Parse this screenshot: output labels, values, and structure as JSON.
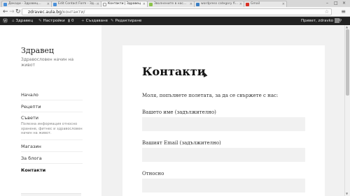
{
  "browser": {
    "tabs": [
      {
        "label": "Декоди - Здравец..."
      },
      {
        "label": "Edit Contact Form - Зд..."
      },
      {
        "label": "Контакти | Здравец"
      },
      {
        "label": "Зволнените в нас..."
      },
      {
        "label": "wordpress category fi..."
      },
      {
        "label": "Gmail"
      }
    ],
    "address": {
      "domain": "zdravec.aula.bg",
      "path": "/контакти/"
    },
    "icons": {
      "back": "back-arrow-icon",
      "forward": "forward-arrow-icon",
      "reload": "reload-icon",
      "star": "star-icon",
      "menu": "hamburger-menu-icon"
    }
  },
  "adminbar": {
    "site": "Здравец",
    "customize": "Настройки",
    "comments": "0",
    "new": "Създаване",
    "edit": "Редактиране",
    "greeting": "Привет, zdravko"
  },
  "sidebar": {
    "title": "Здравец",
    "description": "Здравословен начин на живот",
    "items": [
      {
        "label": "Начало"
      },
      {
        "label": "Рецепти"
      },
      {
        "label": "Съвети",
        "sub": "Полезна информация относно хранене, фитнес и здравословен начин на живот."
      },
      {
        "label": "Магазин"
      },
      {
        "label": "За блога"
      },
      {
        "label": "Контакти"
      }
    ]
  },
  "content": {
    "title": "Контакти",
    "intro": "Моля, попълнете полетата, за да се свържете с нас:",
    "fields": [
      {
        "label": "Вашето име (задължително)"
      },
      {
        "label": "Вашият Email (задължително)"
      },
      {
        "label": "Относно"
      }
    ]
  }
}
